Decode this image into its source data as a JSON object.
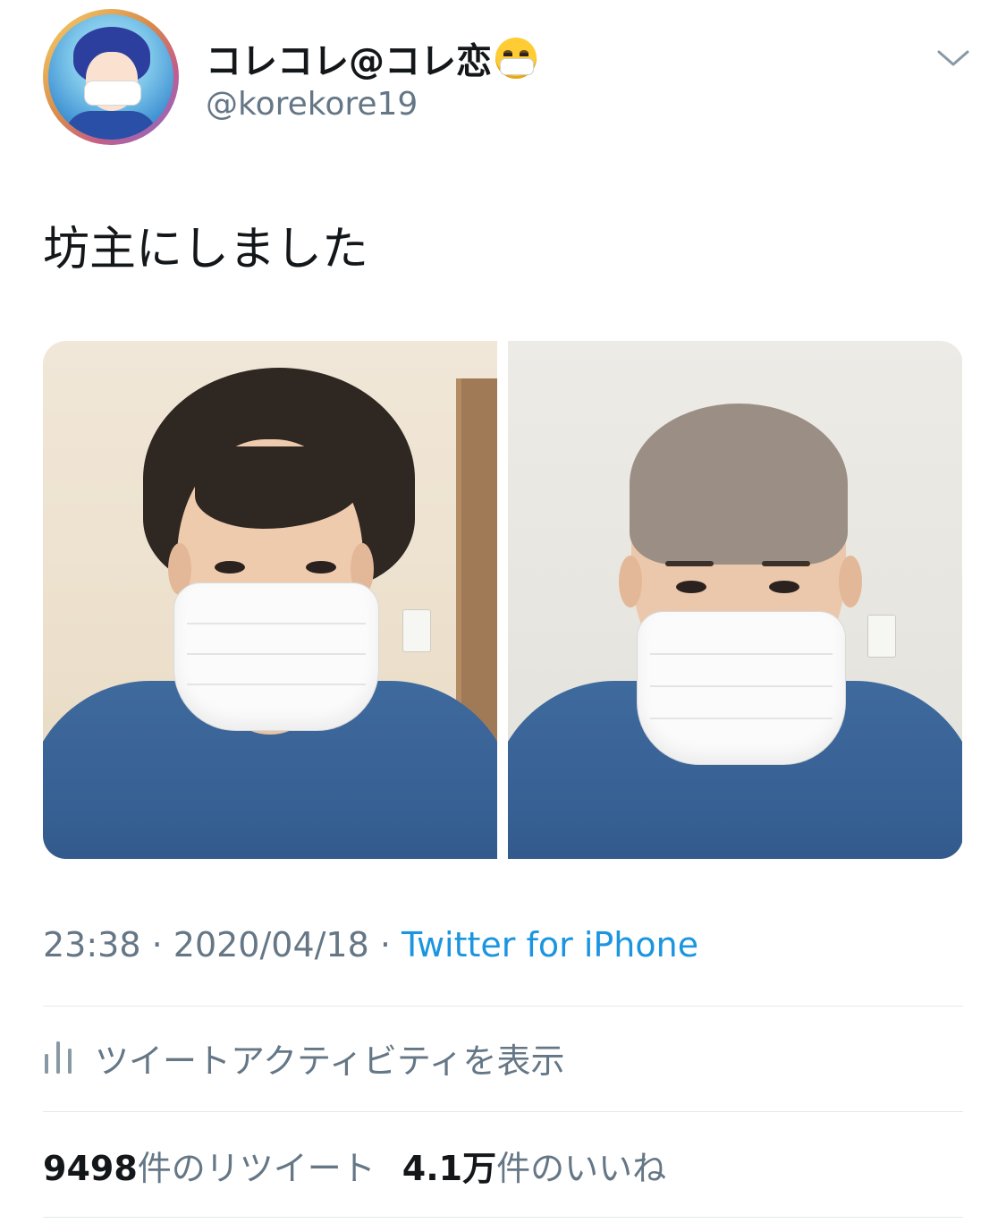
{
  "header": {
    "display_name": "コレコレ@コレ恋",
    "name_emoji_icon": "face-with-medical-mask-icon",
    "handle": "@korekore19",
    "avatar_icon": "anime-avatar",
    "menu_icon": "chevron-down-icon"
  },
  "tweet": {
    "text": "坊主にしました",
    "photos": [
      {
        "name": "photo-before",
        "description_icon": "long-hair-masked-face"
      },
      {
        "name": "photo-after",
        "description_icon": "buzzcut-masked-face"
      }
    ]
  },
  "meta": {
    "time": "23:38",
    "separator": " · ",
    "date": "2020/04/18",
    "source": "Twitter for iPhone"
  },
  "activity": {
    "icon": "bar-chart-icon",
    "label": "ツイートアクティビティを表示"
  },
  "stats": {
    "retweets_count": "9498",
    "retweets_label": "件のリツイート",
    "likes_count": "4.1万",
    "likes_label": "件のいいね"
  },
  "colors": {
    "text_primary": "#14171a",
    "text_secondary": "#657786",
    "link": "#1b95e0",
    "divider": "#e1e8ed"
  }
}
